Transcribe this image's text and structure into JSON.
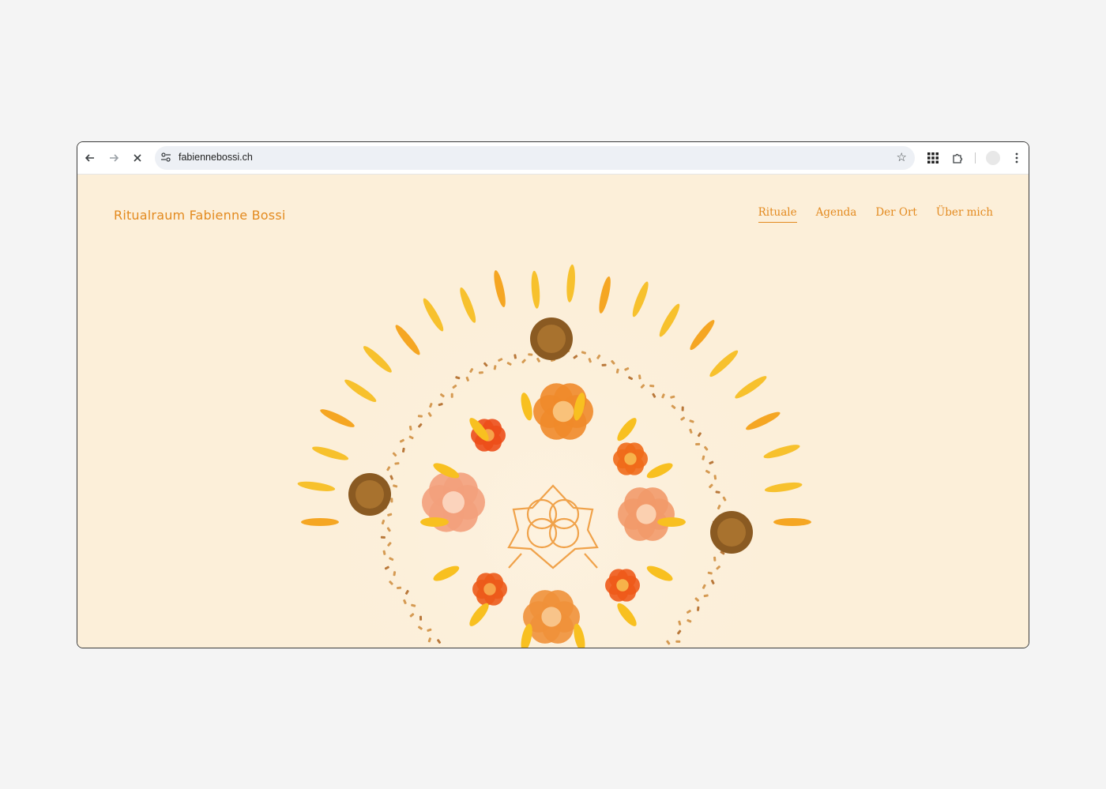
{
  "browser": {
    "url": "fabiennebossi.ch",
    "icons": {
      "back": "arrow-left-icon",
      "forward": "arrow-right-icon",
      "stop": "close-icon",
      "site_info": "tune-icon",
      "bookmark": "star-icon",
      "apps": "grid-icon",
      "extensions": "puzzle-icon",
      "profile": "avatar",
      "menu": "more-vert-icon"
    }
  },
  "site": {
    "title": "Ritualraum Fabienne Bossi",
    "nav": [
      {
        "label": "Rituale",
        "active": true
      },
      {
        "label": "Agenda",
        "active": false
      },
      {
        "label": "Der Ort",
        "active": false
      },
      {
        "label": "Über mich",
        "active": false
      }
    ],
    "hero_image": "flower-mandala-image",
    "accent_color": "#e38a1f",
    "background_color": "#fcefd9"
  }
}
